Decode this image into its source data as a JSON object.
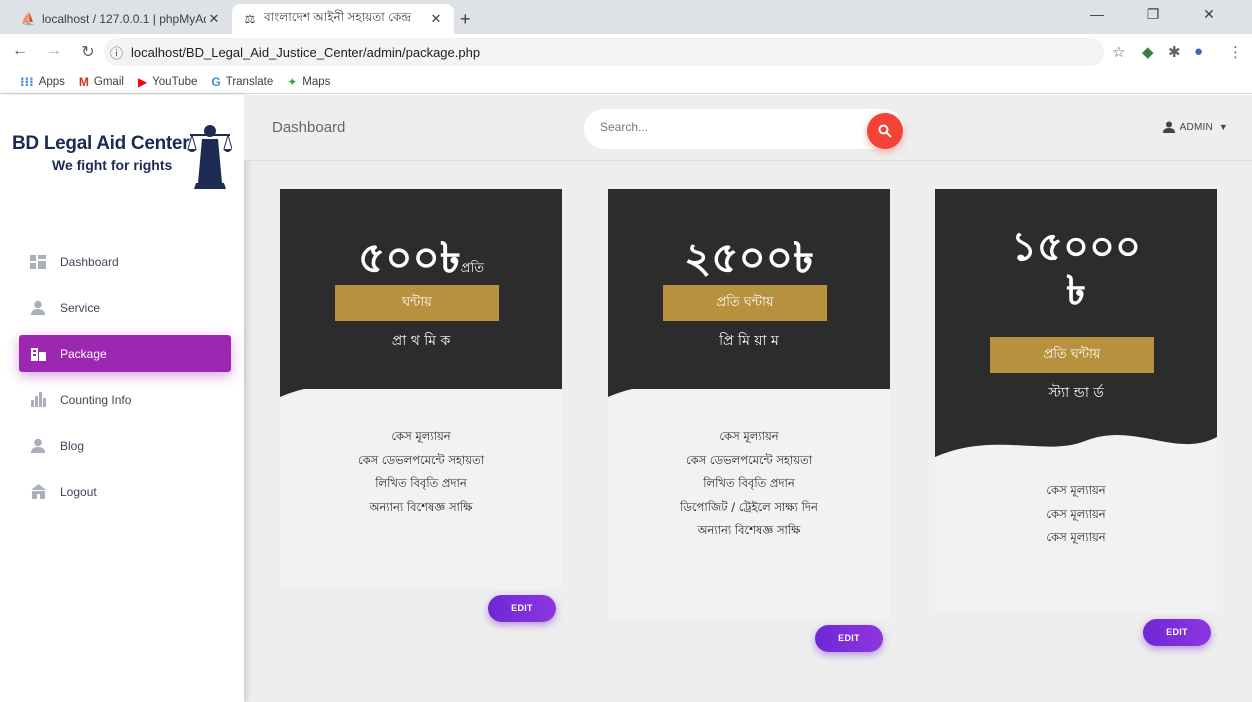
{
  "browser": {
    "tabs": [
      {
        "title": "localhost / 127.0.0.1 | phpMyAdm",
        "favicon": "phpmyadmin-icon"
      },
      {
        "title": "বাংলাদেশ আইনী সহায়তা কেন্দ্র",
        "favicon": "justice-icon"
      }
    ],
    "url": "localhost/BD_Legal_Aid_Justice_Center/admin/package.php",
    "bookmarks": [
      "Apps",
      "Gmail",
      "YouTube",
      "Translate",
      "Maps"
    ]
  },
  "sidebar": {
    "brand_name": "BD Legal Aid Center",
    "brand_tagline": "We fight for rights",
    "items": [
      {
        "label": "Dashboard",
        "icon": "dashboard-icon"
      },
      {
        "label": "Service",
        "icon": "person-icon"
      },
      {
        "label": "Package",
        "icon": "building-icon"
      },
      {
        "label": "Counting Info",
        "icon": "bar-chart-icon"
      },
      {
        "label": "Blog",
        "icon": "person-icon"
      },
      {
        "label": "Logout",
        "icon": "building-icon"
      }
    ],
    "active_index": 2
  },
  "header": {
    "title": "Dashboard",
    "search_placeholder": "Search...",
    "user_label": "ADMIN"
  },
  "packages": [
    {
      "price": "৫০০৳",
      "per": "প্রতি",
      "gold_label": "ঘন্টায়",
      "plan": "প্রা থ মি ক",
      "features": [
        "কেস মূল্যায়ন",
        "কেস ডেভলপমেন্টে সহায়তা",
        "লিখিত বিবৃতি প্রদান",
        "অন্যান্য বিশেষজ্ঞ সাক্ষি"
      ],
      "edit_label": "EDIT"
    },
    {
      "price": "২৫০০৳",
      "per": "",
      "gold_label": "প্রতি ঘন্টায়",
      "plan": "প্রি মি য়া ম",
      "features": [
        "কেস মূল্যায়ন",
        "কেস ডেভলপমেন্টে সহায়তা",
        "লিখিত বিবৃতি প্রদান",
        "ডিপোজিট / ট্রেইলে সাক্ষ্য দিন",
        "অন্যান্য বিশেষজ্ঞ সাক্ষি"
      ],
      "edit_label": "EDIT"
    },
    {
      "price_line1": "১৫০০০",
      "price_line2": "৳",
      "gold_label": "প্রতি ঘন্টায়",
      "plan": "স্ট্যা ন্ডা র্ড",
      "features": [
        "কেস মূল্যায়ন",
        "কেস মূল্যায়ন",
        "কেস মূল্যায়ন"
      ],
      "edit_label": "EDIT"
    }
  ],
  "colors": {
    "active_menu": "#9c27b0",
    "search_button": "#f44336",
    "card_dark": "#2c2c2c",
    "gold": "#b8913f",
    "edit_button": "#7b2fdc"
  }
}
